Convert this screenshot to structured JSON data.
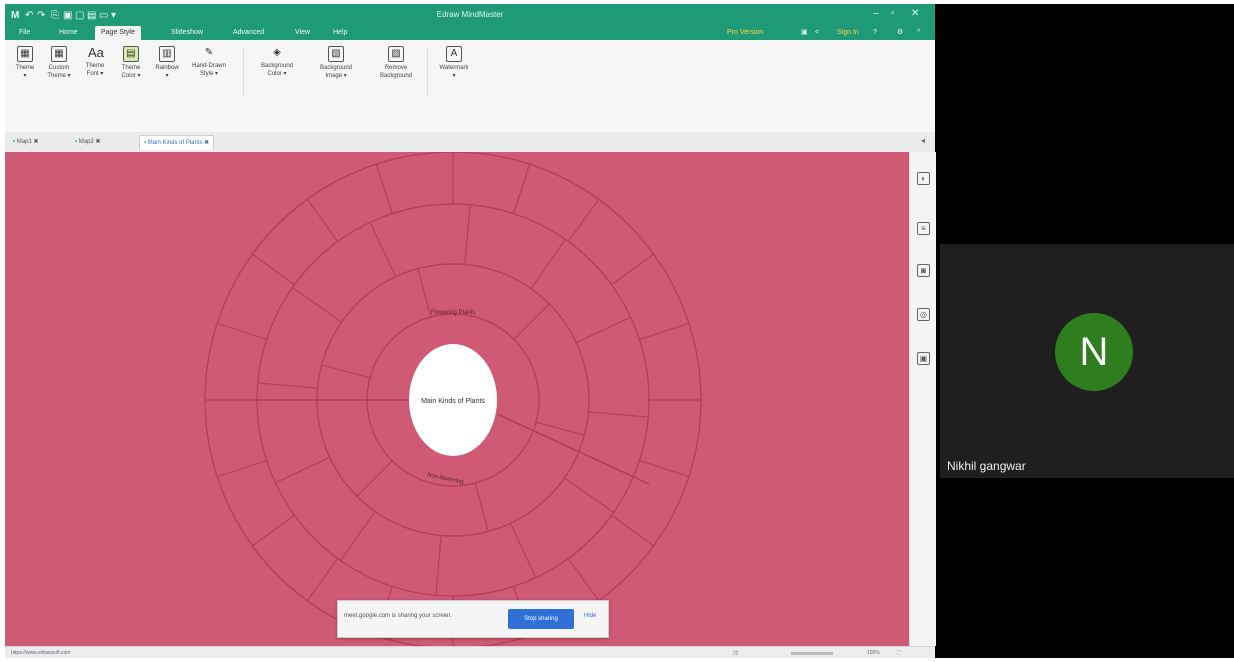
{
  "window": {
    "title": "Edraw MindMaster"
  },
  "quick_access": [
    "↶",
    "↷",
    "⎘",
    "▣",
    "▢",
    "▤",
    "▭",
    "▾"
  ],
  "menu": {
    "items": [
      "File",
      "Home",
      "Page Style",
      "Slideshow",
      "Advanced",
      "View",
      "Help"
    ],
    "active": "Page Style",
    "pro_label": "Pro Version",
    "sign_in": "Sign In"
  },
  "ribbon": {
    "buttons": [
      {
        "icon": "▦",
        "line1": "Theme",
        "line2": "▾"
      },
      {
        "icon": "▦",
        "line1": "Custom",
        "line2": "Theme ▾"
      },
      {
        "icon": "Aa",
        "line1": "Theme",
        "line2": "Font ▾"
      },
      {
        "icon": "▤",
        "line1": "Theme",
        "line2": "Color ▾"
      },
      {
        "icon": "▥",
        "line1": "Rainbow",
        "line2": "▾"
      },
      {
        "icon": "✎",
        "line1": "Hand-Drawn",
        "line2": "Style ▾"
      },
      {
        "icon": "◈",
        "line1": "Background",
        "line2": "Color ▾"
      },
      {
        "icon": "▧",
        "line1": "Background",
        "line2": "Image ▾"
      },
      {
        "icon": "▨",
        "line1": "Remove",
        "line2": "Background"
      },
      {
        "icon": "A",
        "line1": "Watermark",
        "line2": "▾"
      }
    ]
  },
  "tabs": [
    "Map1",
    "Map2",
    "Main Kinds of Plants"
  ],
  "mindmap": {
    "center": "Main Kinds of Plants",
    "branch_top": "Flowering Plants",
    "branch_bottom": "Non-flowering"
  },
  "share_bar": {
    "message": "meet.google.com is sharing your screen.",
    "stop_label": "Stop sharing",
    "hide_label": "Hide"
  },
  "status": {
    "url": "https://www.edrawsoft.com",
    "zoom": "100%"
  },
  "participant": {
    "initial": "N",
    "name": "Nikhil gangwar"
  },
  "colors": {
    "titlebar": "#1f9a76",
    "canvas": "#cf5a74",
    "ring_line": "#b23a55",
    "avatar": "#2e7d1f",
    "stop_button": "#2f6fd6"
  }
}
